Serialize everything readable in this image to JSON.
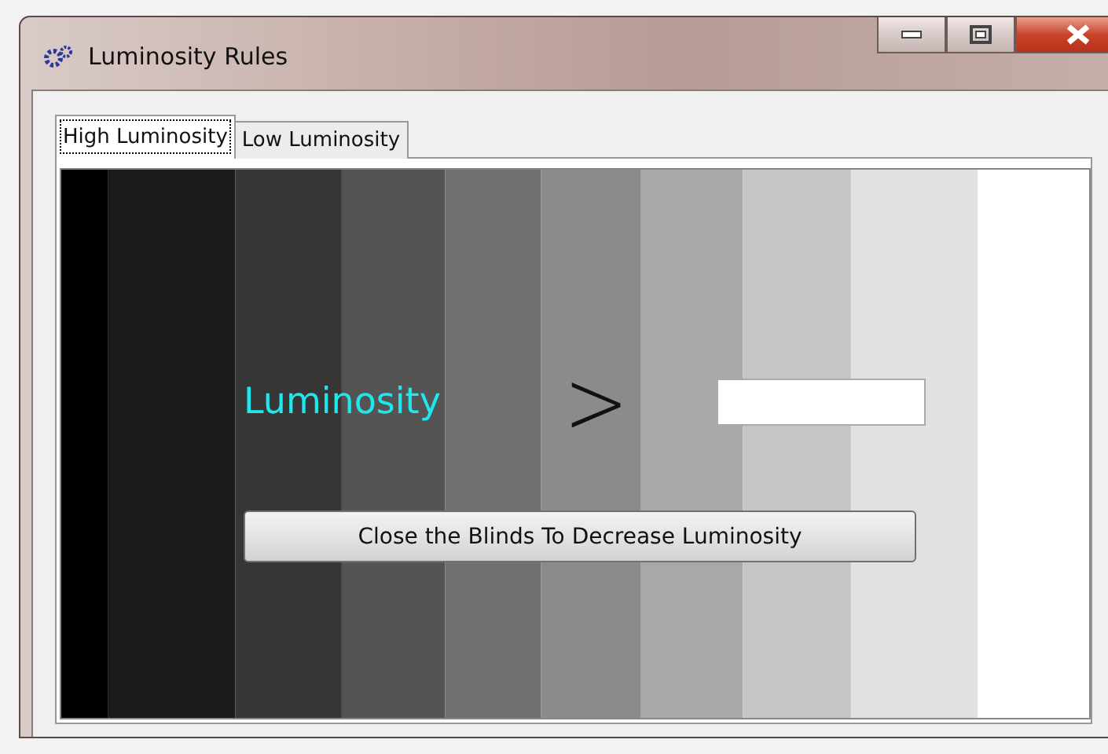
{
  "window": {
    "title": "Luminosity Rules"
  },
  "tabs": [
    {
      "label": "High Luminosity",
      "selected": true
    },
    {
      "label": "Low Luminosity",
      "selected": false
    }
  ],
  "panel": {
    "label": "Luminosity",
    "comparator": ">",
    "button": "Close the Blinds To Decrease Luminosity"
  }
}
